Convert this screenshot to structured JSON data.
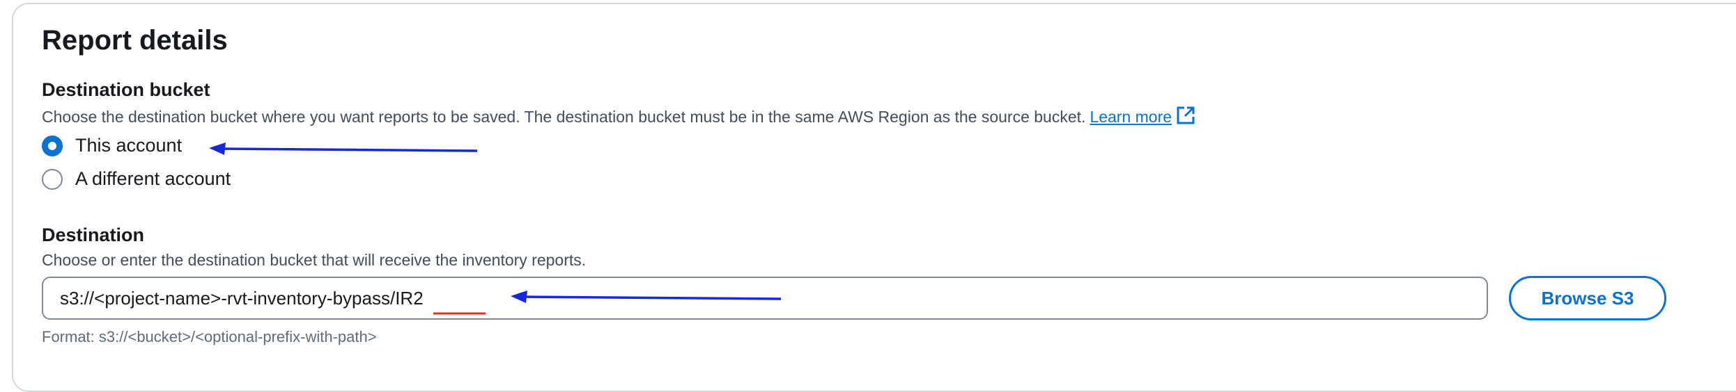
{
  "section": {
    "title": "Report details"
  },
  "destination_bucket": {
    "label": "Destination bucket",
    "description": "Choose the destination bucket where you want reports to be saved. The destination bucket must be in the same AWS Region as the source bucket.",
    "learn_more": "Learn more",
    "learn_more_icon": "external-link-icon",
    "options": [
      {
        "label": "This account",
        "selected": true
      },
      {
        "label": "A different account",
        "selected": false
      }
    ]
  },
  "destination": {
    "label": "Destination",
    "description": "Choose or enter the destination bucket that will receive the inventory reports.",
    "value": "s3://<project-name>-rvt-inventory-bypass/IR2",
    "browse_label": "Browse S3",
    "format_hint": "Format: s3://<bucket>/<optional-prefix-with-path>"
  },
  "annotations": {
    "arrow_color": "#1428e0",
    "underline_color": "#d9301b"
  },
  "colors": {
    "accent": "#0972d3",
    "text": "#16191f",
    "muted": "#414d5c"
  }
}
